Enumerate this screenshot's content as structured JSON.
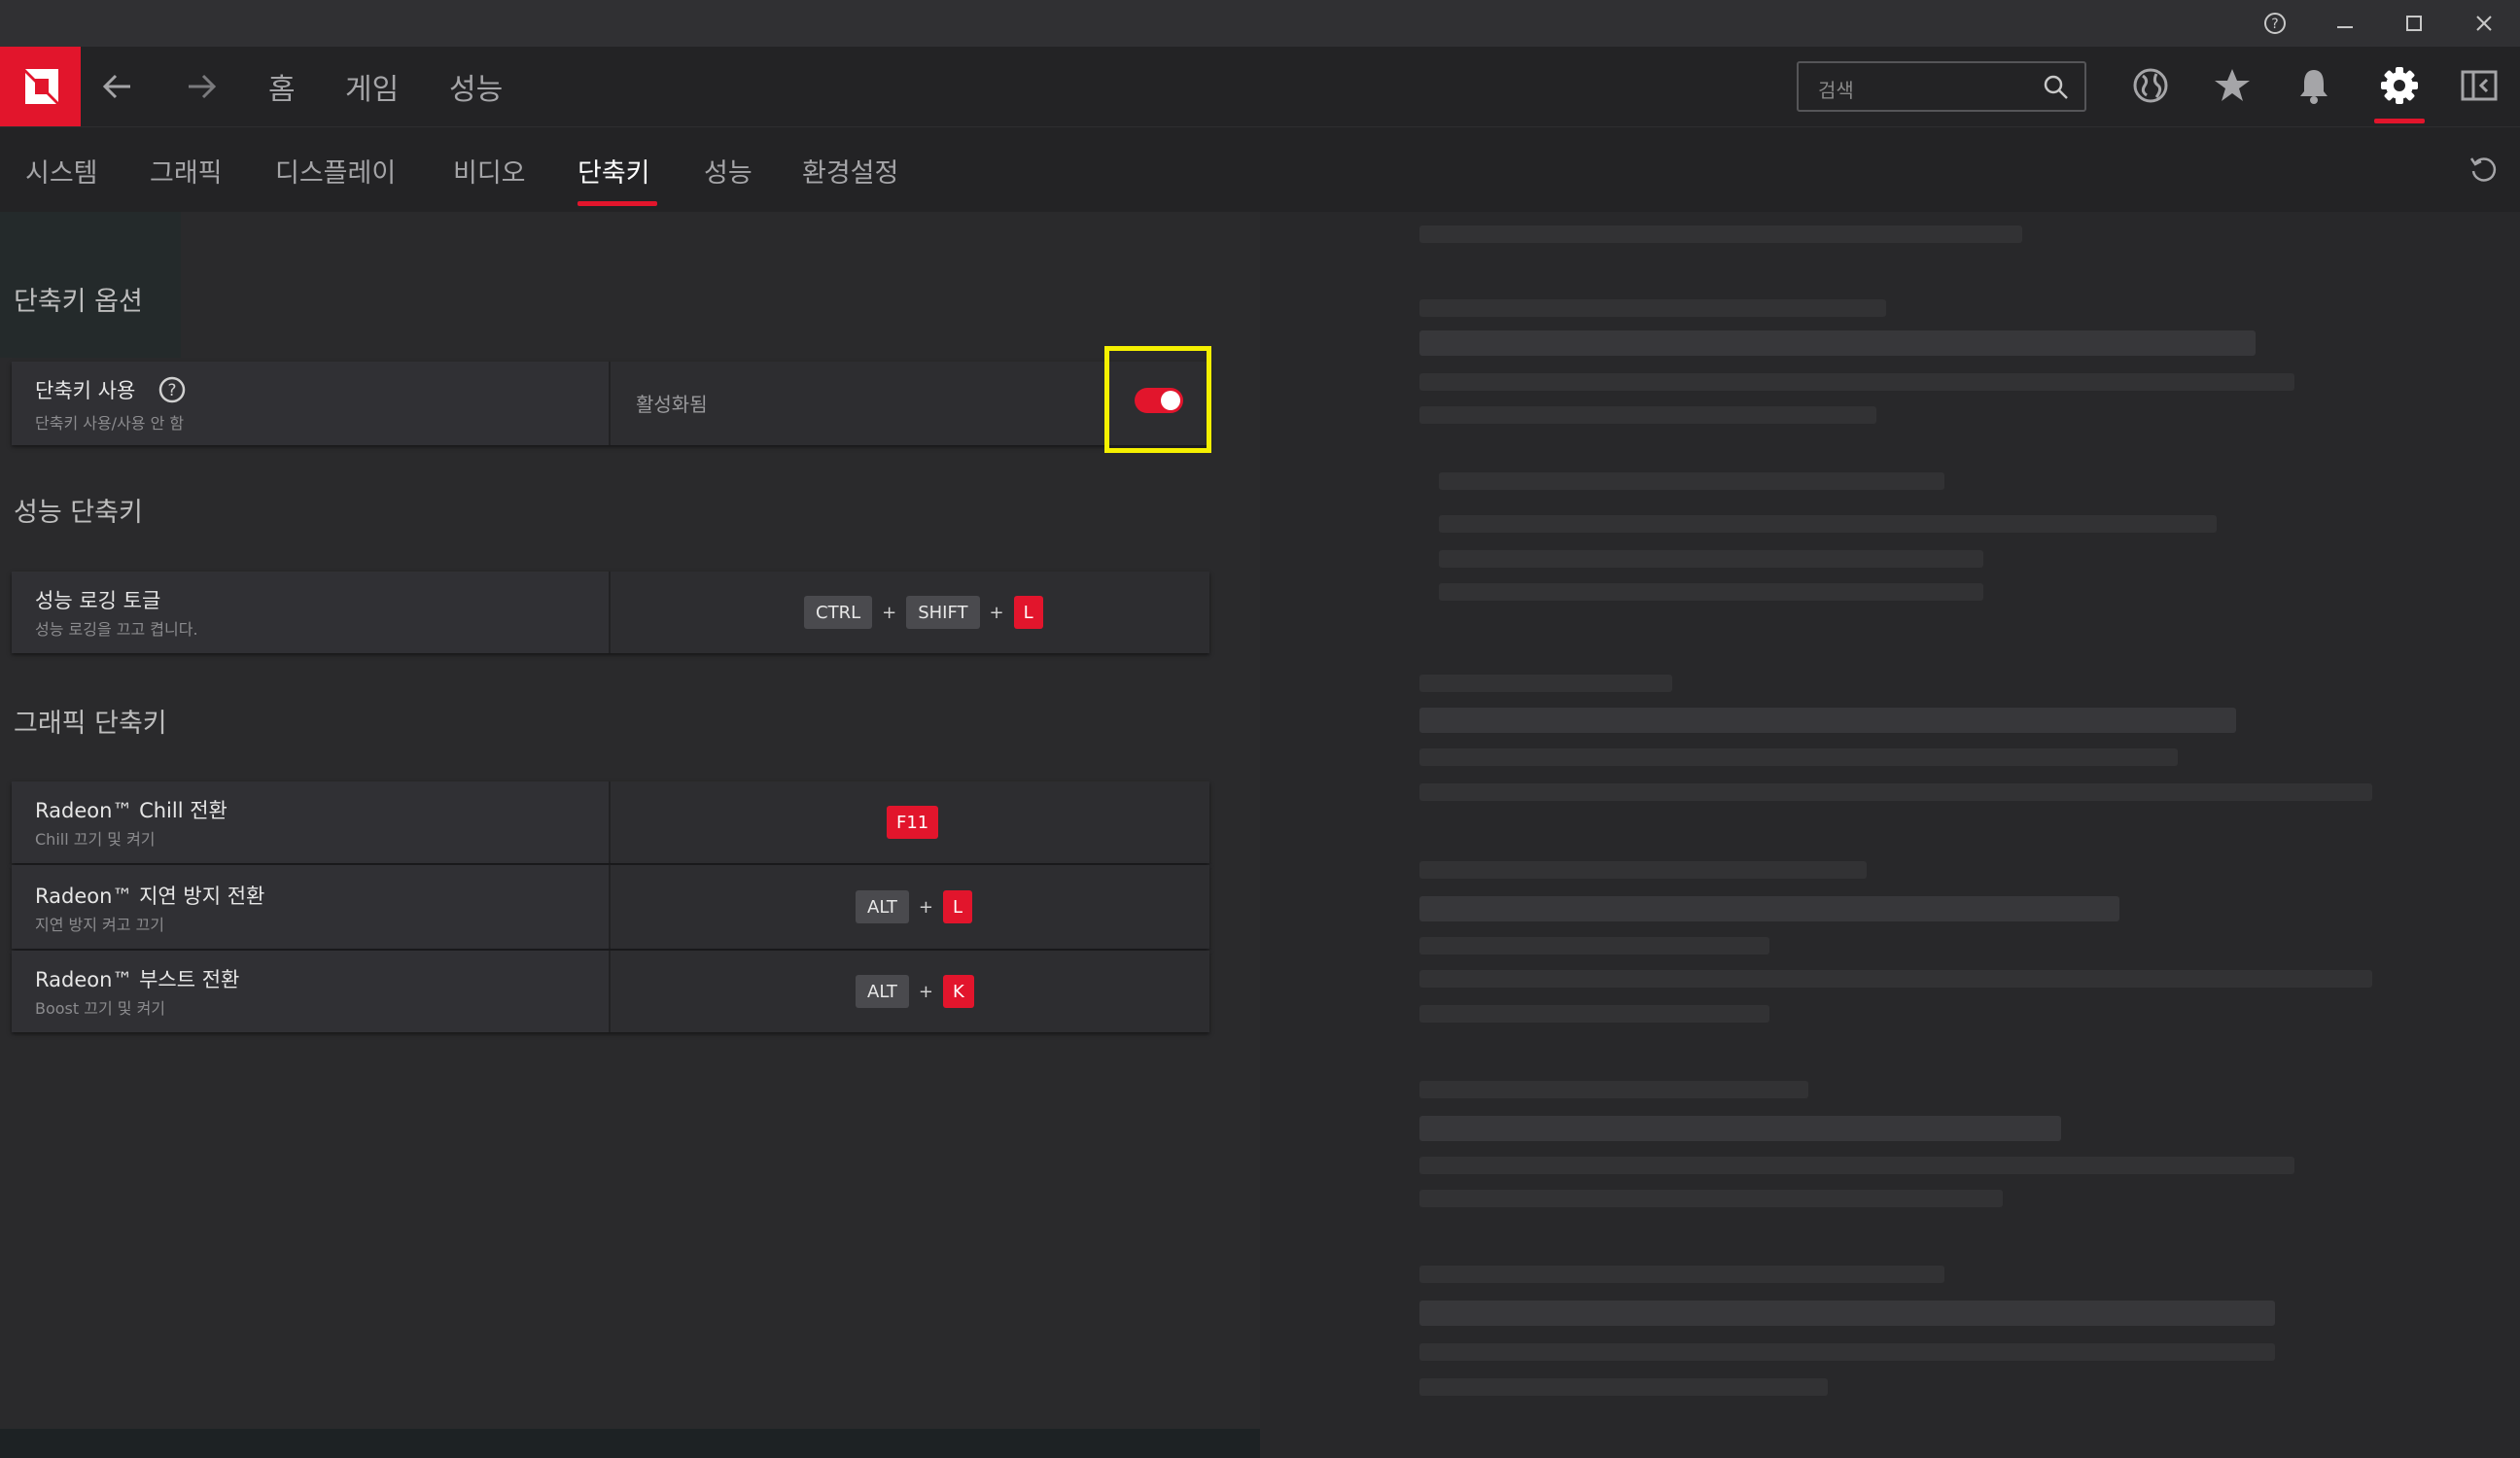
{
  "window": {
    "help": "?"
  },
  "nav": {
    "home": "홈",
    "games": "게임",
    "performance": "성능"
  },
  "search": {
    "placeholder": "검색"
  },
  "tabs": [
    {
      "label": "시스템"
    },
    {
      "label": "그래픽"
    },
    {
      "label": "디스플레이"
    },
    {
      "label": "비디오"
    },
    {
      "label": "단축키",
      "active": true
    },
    {
      "label": "성능"
    },
    {
      "label": "환경설정"
    }
  ],
  "colors": {
    "accent": "#e2152c",
    "highlight": "#f5f000"
  },
  "sections": {
    "options": {
      "title": "단축키 옵션",
      "row": {
        "title": "단축키 사용",
        "subtitle": "단축키 사용/사용 안 함",
        "status": "활성화됨",
        "enabled": true
      }
    },
    "performance": {
      "title": "성능 단축키",
      "rows": [
        {
          "title": "성능 로깅 토글",
          "subtitle": "성능 로깅을 끄고 켭니다.",
          "keys": [
            "CTRL",
            "SHIFT",
            "L"
          ]
        }
      ]
    },
    "graphics": {
      "title": "그래픽 단축키",
      "rows": [
        {
          "title": "Radeon™ Chill 전환",
          "subtitle": "Chill 끄기 및 켜기",
          "keys": [
            "F11"
          ]
        },
        {
          "title": "Radeon™ 지연 방지 전환",
          "subtitle": "지연 방지 켜고 끄기",
          "keys": [
            "ALT",
            "L"
          ]
        },
        {
          "title": "Radeon™ 부스트 전환",
          "subtitle": "Boost 끄기 및 켜기",
          "keys": [
            "ALT",
            "K"
          ]
        }
      ]
    }
  }
}
